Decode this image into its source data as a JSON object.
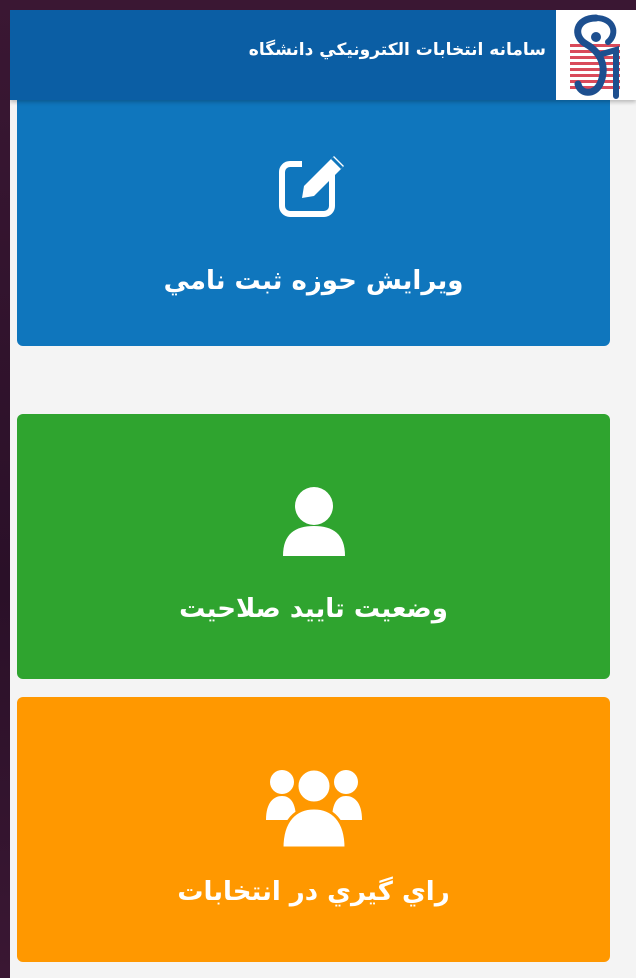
{
  "header": {
    "title": "سامانه انتخابات الكترونيكي دانشگاه",
    "logo_icon": "university-logo-icon"
  },
  "cards": [
    {
      "label": "ويرايش حوزه ثبت نامي",
      "icon": "edit-icon",
      "color": "#0f76bd"
    },
    {
      "label": "وضعيت تاييد صلاحيت",
      "icon": "user-icon",
      "color": "#2fa42f"
    },
    {
      "label": "راي گيري در انتخابات",
      "icon": "users-group-icon",
      "color": "#ff9800"
    }
  ],
  "colors": {
    "header": "#0b5ea4",
    "background": "#f4f4f4"
  }
}
